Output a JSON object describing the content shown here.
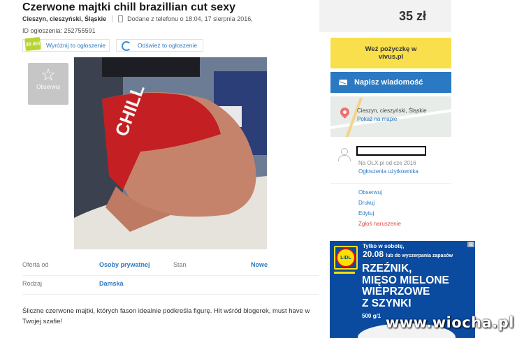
{
  "listing": {
    "title": "Czerwone majtki chill brazillian cut sexy",
    "location": "Cieszyn, cieszyński, Śląskie",
    "added": "Dodane z telefonu o 18:04, 17 sierpnia 2016,",
    "ad_id": "ID ogłoszenia: 252755591",
    "promote_label": "Wyróżnij to ogłoszenie",
    "promote_badge": "30 dni",
    "refresh_label": "Odśwież to ogłoszenie",
    "observe_label": "Obserwuj",
    "details": [
      {
        "label": "Oferta od",
        "value": "Osoby prywatnej"
      },
      {
        "label": "Stan",
        "value": "Nowe"
      },
      {
        "label": "Rodzaj",
        "value": "Damska"
      }
    ],
    "description": "Śliczne czerwone majtki, których fason idealnie podkreśla figurę. Hit wśród blogerek, must have w Twojej szafie!"
  },
  "sidebar": {
    "price": "35 zł",
    "loan_line1": "Weź pożyczkę w",
    "loan_line2": "vivus.pl",
    "message_label": "Napisz wiadomość",
    "map_location": "Cieszyn, cieszyński, Śląskie",
    "map_link": "Pokaż na mapie",
    "user_since": "Na OLX.pl od cze 2016",
    "user_ads": "Ogłoszenia użytkownika",
    "actions": [
      "Obserwuj",
      "Drukuj",
      "Edytuj",
      "Zgłoś naruszenie"
    ]
  },
  "ad": {
    "brand": "LIDL",
    "line1": "Tylko w sobotę,",
    "date": "20.08",
    "date_note": "lub do wyczerpania zapasów",
    "headline": [
      "RZEŹNIK,",
      "MIĘSO MIELONE",
      "WIEPRZOWE",
      "Z SZYNKI"
    ],
    "price_line": "500 g/1",
    "close": "⊠"
  },
  "watermark": "www.wiocha.pl",
  "colors": {
    "link": "#2b79c2",
    "loan": "#f8df4b",
    "message": "#2b79c2",
    "report": "#e04a3f"
  }
}
